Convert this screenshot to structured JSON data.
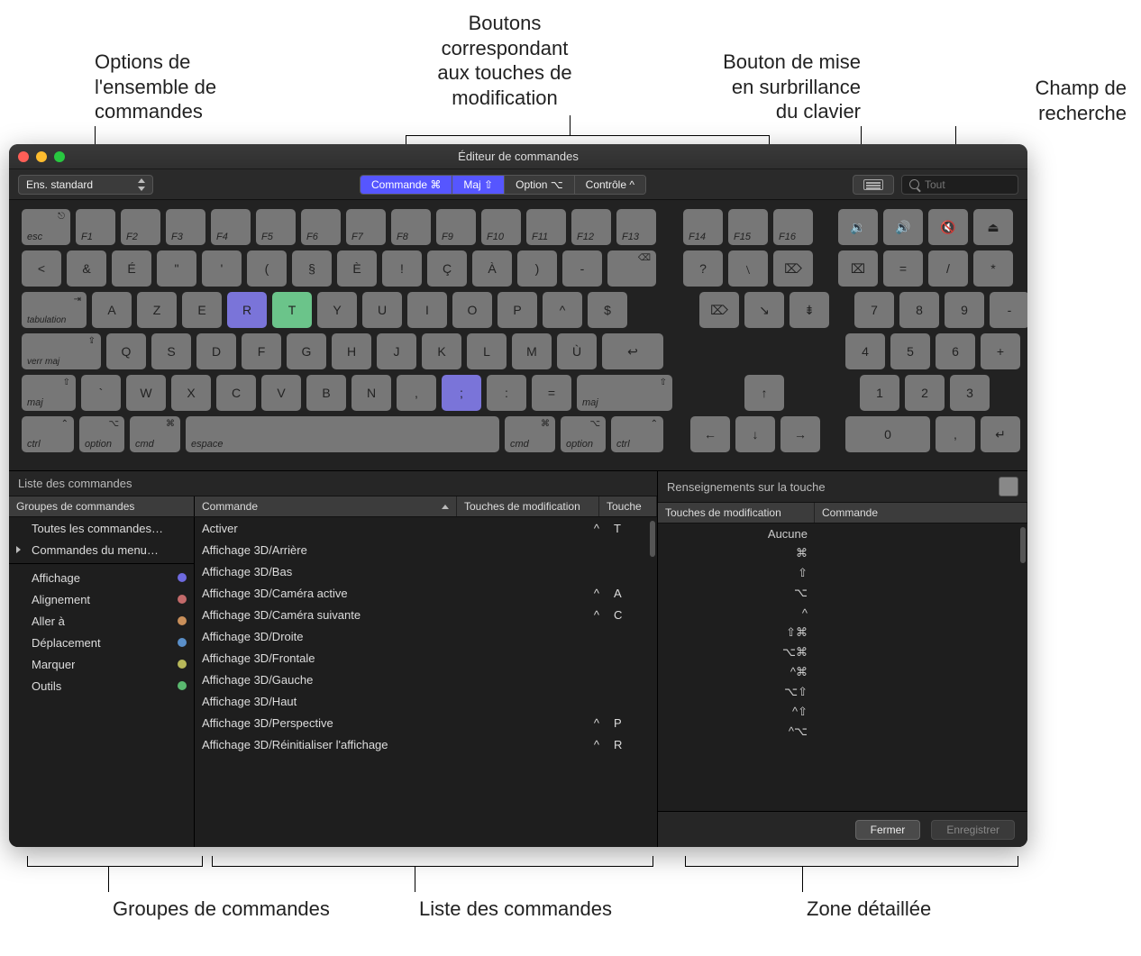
{
  "callouts": {
    "top": {
      "set_options": "Options de\nl'ensemble de\ncommandes",
      "modifier_buttons": "Boutons\ncorrespondant\naux touches de\nmodification",
      "highlight_button": "Bouton de mise\nen surbrillance\ndu clavier",
      "search_field": "Champ de\nrecherche"
    },
    "bottom": {
      "groups": "Groupes de commandes",
      "list": "Liste des commandes",
      "detail": "Zone détaillée"
    }
  },
  "window": {
    "title": "Éditeur de commandes"
  },
  "toolbar": {
    "set_label": "Ens. standard",
    "modifiers": {
      "command": "Commande ⌘",
      "shift": "Maj ⇧",
      "option": "Option ⌥",
      "control": "Contrôle ^"
    },
    "search_placeholder": "Tout"
  },
  "keyboard": {
    "row0": [
      "esc",
      "F1",
      "F2",
      "F3",
      "F4",
      "F5",
      "F6",
      "F7",
      "F8",
      "F9",
      "F10",
      "F11",
      "F12",
      "F13"
    ],
    "row0b": [
      "F14",
      "F15",
      "F16"
    ],
    "row0c": [
      "🔉",
      "🔊",
      "🔇",
      "⏏"
    ],
    "row1": [
      "<",
      "&",
      "É",
      "\"",
      "'",
      "(",
      "§",
      "È",
      "!",
      "Ç",
      "À",
      ")",
      "-"
    ],
    "row1b": [
      "?",
      "﹨",
      "⌦"
    ],
    "row1c": [
      "⌧",
      "=",
      "/",
      "*"
    ],
    "row2_label": "tabulation",
    "row2": [
      "A",
      "Z",
      "E",
      "R",
      "T",
      "Y",
      "U",
      "I",
      "O",
      "P",
      "^",
      "$"
    ],
    "row2b": [
      "⌦",
      "↘",
      "⇟"
    ],
    "row2c": [
      "7",
      "8",
      "9",
      "-"
    ],
    "row3_label": "verr maj",
    "row3": [
      "Q",
      "S",
      "D",
      "F",
      "G",
      "H",
      "J",
      "K",
      "L",
      "M",
      "Ù"
    ],
    "ret": "↩",
    "row3c": [
      "4",
      "5",
      "6",
      "+"
    ],
    "row4_l": "maj",
    "row4": [
      "`",
      "W",
      "X",
      "C",
      "V",
      "B",
      "N",
      ",",
      ";",
      ":",
      "="
    ],
    "row4_r": "maj",
    "row4b": [
      "↑"
    ],
    "row4c": [
      "1",
      "2",
      "3"
    ],
    "row5": {
      "ctrl": "ctrl",
      "option": "option",
      "cmd": "cmd",
      "space": "espace",
      "cmd2": "cmd",
      "option2": "option",
      "ctrl2": "ctrl"
    },
    "row5b": [
      "←",
      "↓",
      "→"
    ],
    "row5c": [
      "0",
      ",",
      "↵"
    ]
  },
  "left_panel": {
    "title": "Liste des commandes",
    "groups_header": "Groupes de commandes",
    "command_header": "Commande",
    "mod_header": "Touches de modification",
    "key_header": "Touche",
    "groups": [
      {
        "label": "Toutes les commandes…",
        "indent": true
      },
      {
        "label": "Commandes du menu…",
        "disclosure": true
      }
    ],
    "color_groups": [
      {
        "label": "Affichage",
        "color": "#6e6adf"
      },
      {
        "label": "Alignement",
        "color": "#c36a6a"
      },
      {
        "label": "Aller à",
        "color": "#c98f5a"
      },
      {
        "label": "Déplacement",
        "color": "#5a8fc9"
      },
      {
        "label": "Marquer",
        "color": "#b8b85a"
      },
      {
        "label": "Outils",
        "color": "#5ab86f"
      }
    ],
    "rows": [
      {
        "cmd": "Activer",
        "mod": "^",
        "key": "T"
      },
      {
        "cmd": "Affichage 3D/Arrière",
        "mod": "",
        "key": ""
      },
      {
        "cmd": "Affichage 3D/Bas",
        "mod": "",
        "key": ""
      },
      {
        "cmd": "Affichage 3D/Caméra active",
        "mod": "^",
        "key": "A"
      },
      {
        "cmd": "Affichage 3D/Caméra suivante",
        "mod": "^",
        "key": "C"
      },
      {
        "cmd": "Affichage 3D/Droite",
        "mod": "",
        "key": ""
      },
      {
        "cmd": "Affichage 3D/Frontale",
        "mod": "",
        "key": ""
      },
      {
        "cmd": "Affichage 3D/Gauche",
        "mod": "",
        "key": ""
      },
      {
        "cmd": "Affichage 3D/Haut",
        "mod": "",
        "key": ""
      },
      {
        "cmd": "Affichage 3D/Perspective",
        "mod": "^",
        "key": "P"
      },
      {
        "cmd": "Affichage 3D/Réinitialiser l'affichage",
        "mod": "^",
        "key": "R"
      }
    ]
  },
  "right_panel": {
    "title": "Renseignements sur la touche",
    "mod_header": "Touches de modification",
    "cmd_header": "Commande",
    "rows": [
      "Aucune",
      "⌘",
      "⇧",
      "⌥",
      "^",
      "⇧⌘",
      "⌥⌘",
      "^⌘",
      "⌥⇧",
      "^⇧",
      "^⌥"
    ]
  },
  "footer": {
    "close": "Fermer",
    "save": "Enregistrer"
  }
}
